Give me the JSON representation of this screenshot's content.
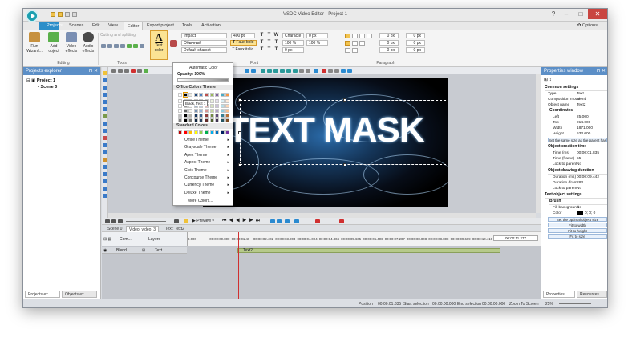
{
  "window": {
    "title": "VSDC Video Editor - Project 1"
  },
  "menu": {
    "items": [
      "Projects",
      "Scenes",
      "Edit",
      "View",
      "Editor",
      "Export project",
      "Tools",
      "Activation"
    ],
    "options": "Options"
  },
  "ribbon": {
    "run_wizard": "Run Wizard...",
    "add_object": "Add object",
    "video_effects": "Video effects",
    "audio_effects": "Audio effects",
    "editing_group": "Editing",
    "tools_group": "Tools",
    "cutting_splitting": "Cutting and splitting",
    "text_color": "Text color",
    "font_name": "Impact",
    "font_style": "Обычный",
    "charset": "Default charset",
    "font_size": "400 pt",
    "faux_bold": "Faux bold",
    "faux_italic": "Faux italic",
    "charac": "Characte",
    "scale_h": "100 %",
    "scale_v": "100 %",
    "spacing1": "0 px",
    "spacing2": "0 px",
    "spacing3": "0 px",
    "font_group": "Font",
    "para_group": "Paragraph",
    "para_px": [
      "0 px",
      "0 px",
      "0 px",
      "0 px",
      "0 px",
      "0 px"
    ]
  },
  "color_popup": {
    "automatic": "Automatic Color",
    "opacity": "Opacity: 100%",
    "office_header": "Office Colors Theme",
    "tooltip": "Black, Text 1",
    "standard_header": "Standard Colors",
    "themes": [
      "Office Theme",
      "Grayscale Theme",
      "Apex Theme",
      "Aspect Theme",
      "Civic Theme",
      "Concourse Theme",
      "Currency Theme",
      "Deluxe Theme"
    ],
    "more": "More Colors...",
    "theme_colors": [
      "#ffffff",
      "#000000",
      "#eeece1",
      "#1f497d",
      "#4f81bd",
      "#c0504d",
      "#9bbb59",
      "#8064a2",
      "#4bacc6",
      "#f79646"
    ],
    "standard_colors": [
      "#c00000",
      "#ff0000",
      "#ffc000",
      "#ffff00",
      "#92d050",
      "#00b050",
      "#00b0f0",
      "#0070c0",
      "#002060",
      "#7030a0"
    ]
  },
  "projects_explorer": {
    "title": "Projects explorer",
    "project": "Project 1",
    "scene": "Scene 0",
    "tab_projects": "Projects ex...",
    "tab_objects": "Objects ex..."
  },
  "canvas": {
    "text": "TEXT MASK"
  },
  "properties": {
    "title": "Properties window",
    "common": "Common settings",
    "type_k": "Type",
    "type_v": "Text",
    "comp_k": "Composition mode",
    "comp_v": "Blend",
    "name_k": "Object name",
    "name_v": "Text2",
    "coords": "Coordinates",
    "left_k": "Left",
    "left_v": "25.000",
    "top_k": "Top",
    "top_v": "214.000",
    "width_k": "Width",
    "width_v": "1871.000",
    "height_k": "Height",
    "height_v": "533.000",
    "same_size": "Set the same size as the parent has",
    "creation": "Object creation time",
    "time_ms_k": "Time (ms)",
    "time_ms_v": "00:00:01.835",
    "time_fr_k": "Time (frame)",
    "time_fr_v": "55",
    "lock1_k": "Lock to parent",
    "lock1_v": "No",
    "drawing": "Object drawing duration",
    "dur_ms_k": "Duration (ms)",
    "dur_ms_v": "00:00:09.442",
    "dur_fr_k": "Duration (fram",
    "dur_fr_v": "283",
    "lock2_k": "Lock to parent",
    "lock2_v": "No",
    "text_settings": "Text object settings",
    "brush": "Brush",
    "fill_k": "Fill background",
    "fill_v": "No",
    "color_k": "Color",
    "color_v": "0; 0; 0",
    "optimal": "Set the optimal object size",
    "fit_width": "Fit to width",
    "fit_height": "Fit to height",
    "fit_size": "Fit to size",
    "tab_properties": "Properties ...",
    "tab_resources": "Resources ..."
  },
  "timeline": {
    "preview": "Preview",
    "tabs": [
      "Scene 0",
      "Video: video_3",
      "Text: Text2"
    ],
    "com": "Com...",
    "layers": "Layers",
    "blend": "Blend",
    "text_row": "Text",
    "clip_label": "Text2",
    "cursor_time": "00:00:11.277",
    "ticks": [
      "0.000",
      "00:00:00.800",
      "00:00:01.40",
      "00:00:02.402",
      "00:00:03.203",
      "00:00:04.004",
      "00:00:04.804",
      "00:00:05.605",
      "00:00:06.406",
      "00:00:07.207",
      "00:00:08.008",
      "00:00:08.808",
      "00:00:09.609",
      "00:00:10.410",
      "00:00:11.211",
      "00:00:12.012"
    ]
  },
  "status": {
    "position": "Position",
    "position_v": "00:00:01.835",
    "start_sel": "Start selection",
    "start_sel_v": "00:00:00.000",
    "end_sel": "End selection",
    "end_sel_v": "00:00:00.000",
    "zoom": "Zoom To Screen",
    "zoom_v": "25%"
  }
}
